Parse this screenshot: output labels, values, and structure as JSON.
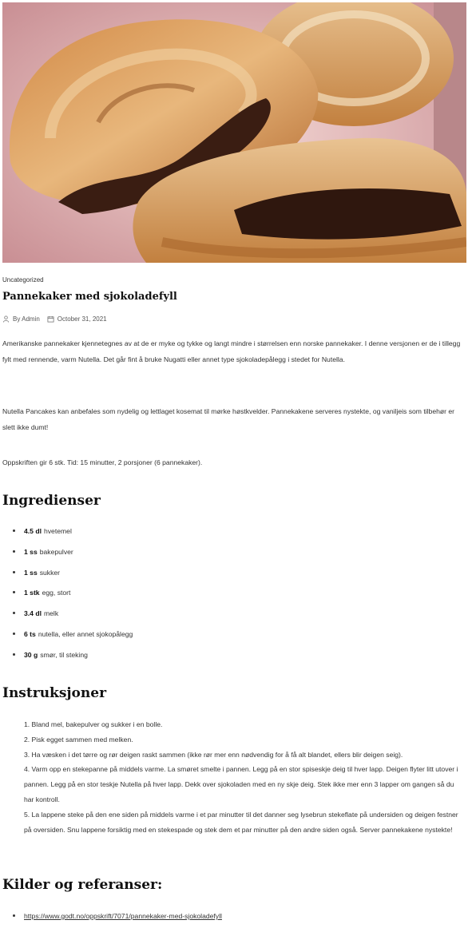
{
  "post": {
    "category": "Uncategorized",
    "title": "Pannekaker med sjokoladefyll",
    "author": "By Admin",
    "date": "October 31, 2021"
  },
  "intro": [
    "Amerikanske pannekaker kjennetegnes av at de er myke og tykke og langt mindre i størrelsen enn norske pannekaker. I denne versjonen er de i tillegg fylt med rennende, varm Nutella. Det går fint å bruke Nugatti eller annet type sjokoladepålegg i stedet for Nutella.",
    "Nutella Pancakes kan anbefales som nydelig og lettlaget kosemat til mørke høstkvelder. Pannekakene serveres nystekte, og vaniljeis som tilbehør er slett ikke dumt!",
    "Oppskriften gir 6 stk. Tid: 15 minutter, 2 porsjoner (6 pannekaker)."
  ],
  "ingredients": {
    "heading": "Ingredienser",
    "items": [
      {
        "qty": "4.5 dl",
        "name": "hvetemel"
      },
      {
        "qty": "1 ss",
        "name": "bakepulver"
      },
      {
        "qty": "1 ss",
        "name": "sukker"
      },
      {
        "qty": "1 stk",
        "name": "egg, stort"
      },
      {
        "qty": "3.4 dl",
        "name": "melk"
      },
      {
        "qty": "6 ts",
        "name": "nutella, eller annet sjokopålegg"
      },
      {
        "qty": "30 g",
        "name": "smør, til steking"
      }
    ]
  },
  "instructions": {
    "heading": "Instruksjoner",
    "steps": [
      "1. Bland mel, bakepulver og sukker i en bolle.",
      "2. Pisk egget sammen med melken.",
      "3. Ha væsken i det tørre og rør deigen raskt sammen (ikke rør mer enn nødvendig for å få alt blandet, ellers blir deigen seig).",
      "4. Varm opp en stekepanne på middels varme. La smøret smelte i pannen. Legg på en stor spiseskje deig til hver lapp. Deigen flyter litt utover i pannen. Legg på en stor teskje Nutella på hver lapp. Dekk over sjokoladen med en ny skje deig. Stek ikke mer enn 3 lapper om gangen så du har kontroll.",
      "5. La lappene steke på den ene siden på middels varme i et par minutter til det danner seg lysebrun stekeflate på undersiden og deigen festner på oversiden. Snu lappene forsiktig med en stekespade og stek dem et par minutter på den andre siden også. Server pannekakene nystekte!"
    ]
  },
  "sources": {
    "heading": "Kilder og referanser:",
    "links": [
      "https://www.godt.no/oppskrift/7071/pannekaker-med-sjokoladefyll"
    ]
  }
}
